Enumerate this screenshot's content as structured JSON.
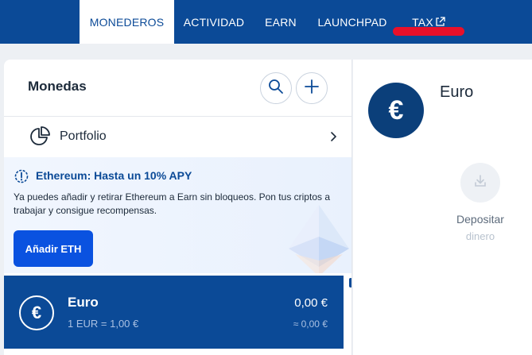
{
  "nav": {
    "tabs": [
      {
        "label": "MONEDEROS",
        "active": true
      },
      {
        "label": "ACTIVIDAD",
        "active": false
      },
      {
        "label": "EARN",
        "active": false
      },
      {
        "label": "LAUNCHPAD",
        "active": false
      },
      {
        "label": "TAX",
        "active": false,
        "icon": "external-link-icon"
      }
    ]
  },
  "coins_panel": {
    "title": "Monedas",
    "search_icon": "search-icon",
    "add_icon": "plus-icon",
    "portfolio": {
      "label": "Portfolio",
      "icon": "pie-chart-icon"
    },
    "promo": {
      "title": "Ethereum: Hasta un 10% APY",
      "text": "Ya puedes añadir y retirar Ethereum a Earn sin bloqueos. Pon tus criptos a trabajar y consigue recompensas.",
      "button": "Añadir ETH",
      "icon": "info-gear-icon"
    },
    "coins": [
      {
        "name": "Euro",
        "symbol": "€",
        "rate": "1 EUR = 1,00 €",
        "balance": "0,00 €",
        "approx": "≈ 0,00 €",
        "selected": true
      }
    ]
  },
  "detail": {
    "symbol": "€",
    "title": "Euro",
    "deposit_label": "Depositar",
    "deposit_sub": "dinero"
  },
  "colors": {
    "brand": "#0b4a97",
    "button": "#0a52e0",
    "highlight": "#e8102a"
  }
}
